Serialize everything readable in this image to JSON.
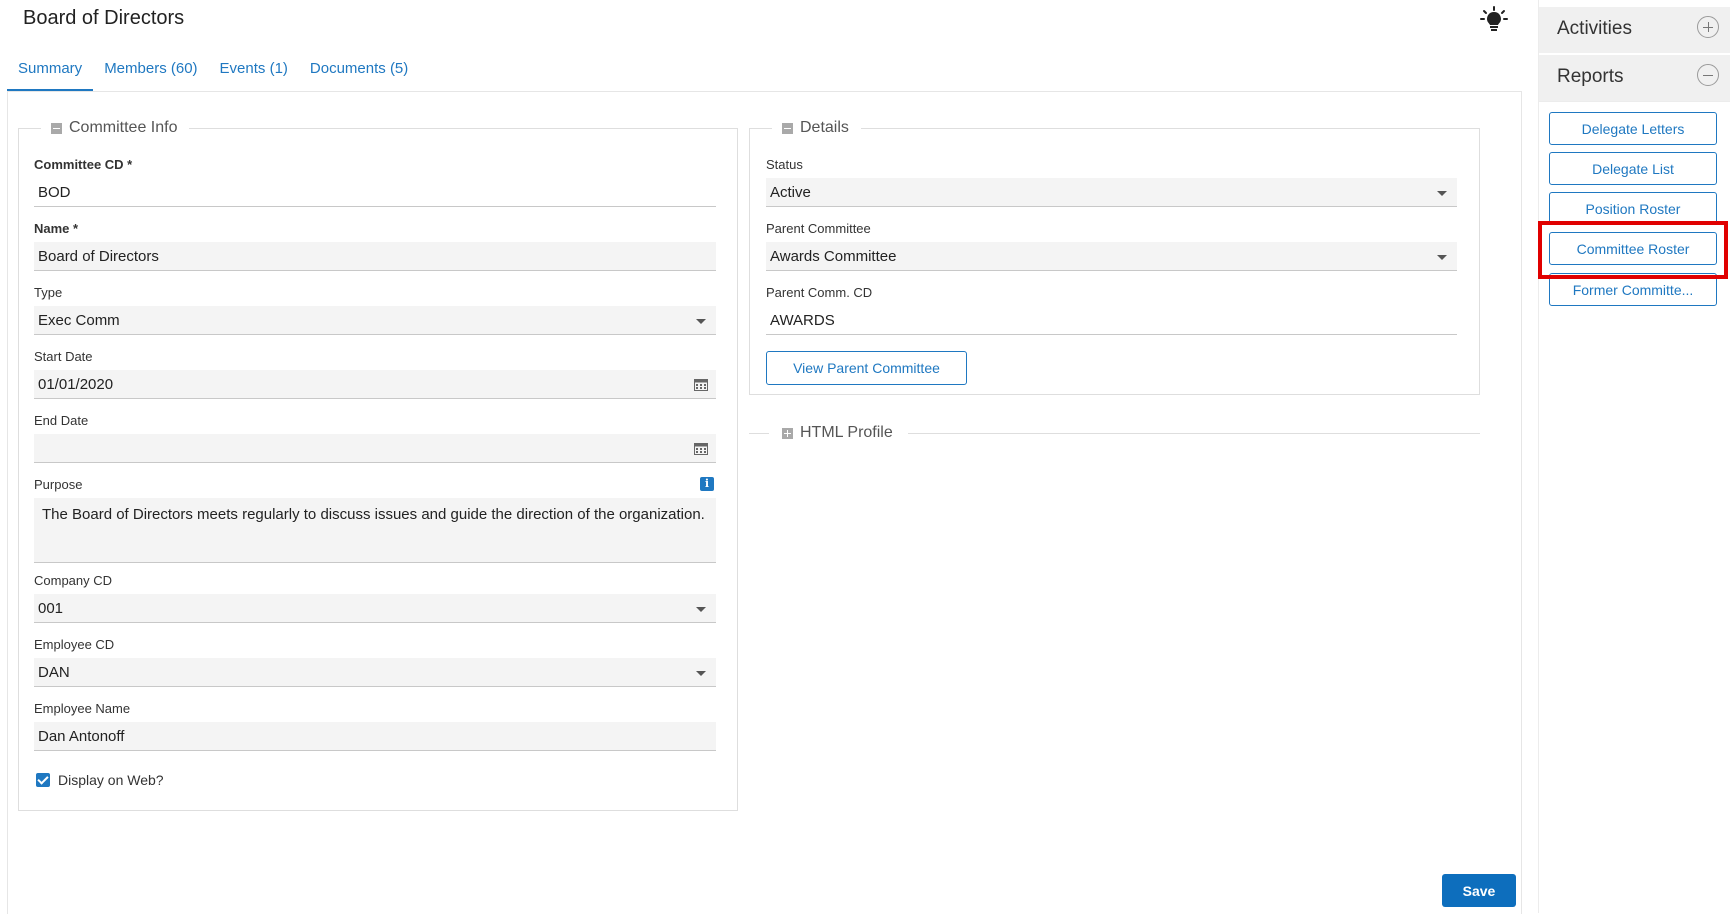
{
  "page": {
    "title": "Board of Directors"
  },
  "tabs": [
    {
      "label": "Summary",
      "active": true
    },
    {
      "label": "Members (60)",
      "active": false
    },
    {
      "label": "Events (1)",
      "active": false
    },
    {
      "label": "Documents (5)",
      "active": false
    }
  ],
  "committee_info": {
    "legend": "Committee Info",
    "committee_cd": {
      "label": "Committee CD *",
      "value": "BOD"
    },
    "name": {
      "label": "Name *",
      "value": "Board of Directors"
    },
    "type": {
      "label": "Type",
      "value": "Exec Comm"
    },
    "start_date": {
      "label": "Start Date",
      "value": "01/01/2020"
    },
    "end_date": {
      "label": "End Date",
      "value": ""
    },
    "purpose": {
      "label": "Purpose",
      "value": "The Board of Directors meets regularly to discuss issues and guide the direction of the organization."
    },
    "company_cd": {
      "label": "Company CD",
      "value": "001"
    },
    "employee_cd": {
      "label": "Employee CD",
      "value": "DAN"
    },
    "employee_name": {
      "label": "Employee Name",
      "value": "Dan Antonoff"
    },
    "display_on_web": {
      "label": "Display on Web?",
      "checked": true
    }
  },
  "details": {
    "legend": "Details",
    "status": {
      "label": "Status",
      "value": "Active"
    },
    "parent_committee": {
      "label": "Parent Committee",
      "value": "Awards Committee"
    },
    "parent_comm_cd": {
      "label": "Parent Comm. CD",
      "value": "AWARDS"
    },
    "view_parent_label": "View Parent Committee"
  },
  "html_profile": {
    "legend": "HTML Profile"
  },
  "save_label": "Save",
  "sidebar": {
    "activities_label": "Activities",
    "reports_label": "Reports",
    "reports": [
      {
        "label": "Delegate Letters"
      },
      {
        "label": "Delegate List"
      },
      {
        "label": "Position Roster"
      },
      {
        "label": "Committee Roster"
      },
      {
        "label": "Former Committe..."
      }
    ]
  },
  "colors": {
    "accent": "#1f78c1",
    "save": "#0d6ebd",
    "highlight": "#e00000"
  },
  "icons": [
    "lightbulb-icon",
    "calendar-icon",
    "info-icon",
    "chevron-down-icon",
    "plus-circle-icon",
    "minus-circle-icon",
    "collapse-icon",
    "expand-icon",
    "checkbox-checked-icon"
  ]
}
